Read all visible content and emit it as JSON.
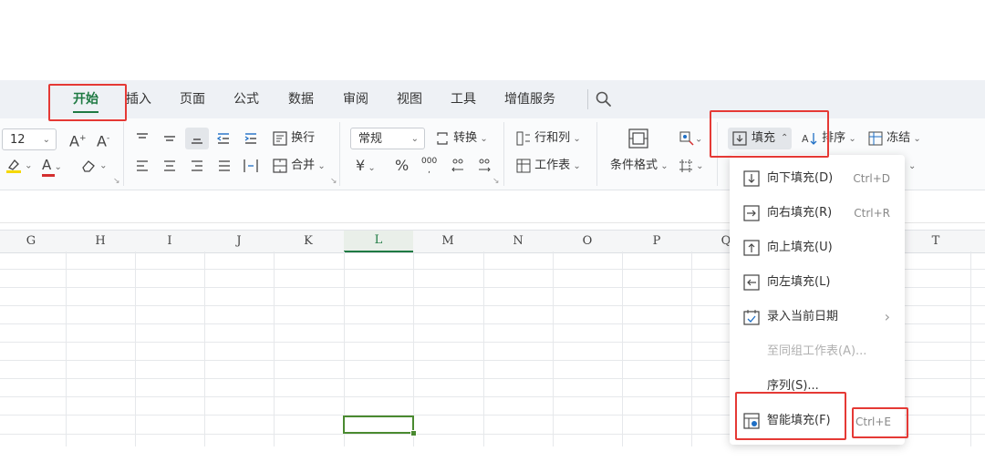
{
  "tabs": [
    {
      "label": "开始"
    },
    {
      "label": "插入"
    },
    {
      "label": "页面"
    },
    {
      "label": "公式"
    },
    {
      "label": "数据"
    },
    {
      "label": "审阅"
    },
    {
      "label": "视图"
    },
    {
      "label": "工具"
    },
    {
      "label": "增值服务"
    }
  ],
  "active_tab": "开始",
  "ribbon": {
    "font_size": "12",
    "wrap_label": "换行",
    "merge_label": "合并",
    "number_format": "常规",
    "convert_label": "转换",
    "row_col_label": "行和列",
    "worksheet_label": "工作表",
    "cond_format_label": "条件格式",
    "fill_label": "填充",
    "sort_label": "排序",
    "freeze_label": "冻结",
    "currency_symbol": "¥",
    "percent_symbol": "%",
    "thousands_symbol": "000"
  },
  "columns": [
    "G",
    "H",
    "I",
    "J",
    "K",
    "L",
    "M",
    "N",
    "O",
    "P",
    "Q",
    "T"
  ],
  "selected_column": "L",
  "fill_menu": {
    "items": [
      {
        "label": "向下填充(D)",
        "shortcut": "Ctrl+D"
      },
      {
        "label": "向右填充(R)",
        "shortcut": "Ctrl+R"
      },
      {
        "label": "向上填充(U)",
        "shortcut": ""
      },
      {
        "label": "向左填充(L)",
        "shortcut": ""
      },
      {
        "label": "录入当前日期",
        "shortcut": ""
      },
      {
        "label": "至同组工作表(A)...",
        "shortcut": ""
      },
      {
        "label": "序列(S)...",
        "shortcut": ""
      },
      {
        "label": "智能填充(F)",
        "shortcut": "Ctrl+E"
      }
    ]
  },
  "colors": {
    "accent_green": "#1f7a43",
    "highlight_red": "#e53935"
  }
}
